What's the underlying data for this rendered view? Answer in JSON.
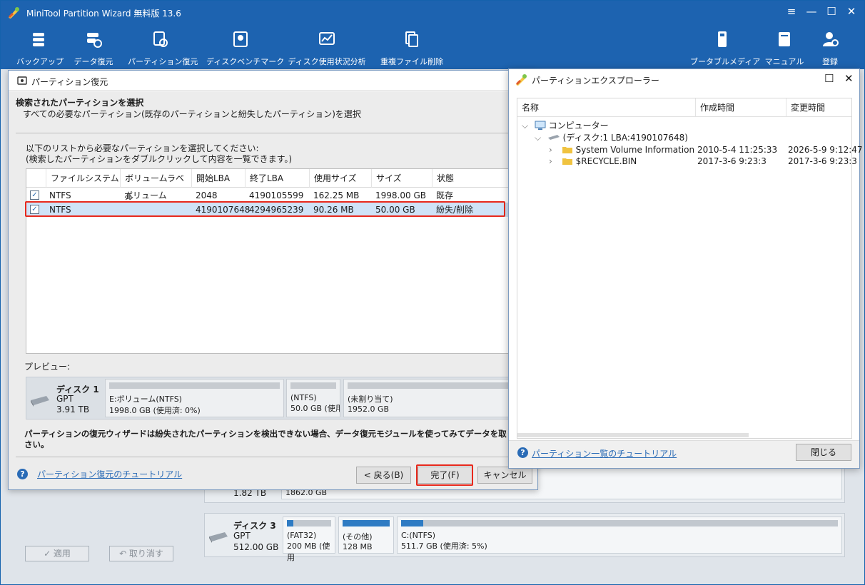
{
  "app": {
    "title": "MiniTool Partition Wizard 無料版 13.6",
    "toolbar": [
      {
        "label": "バックアップ",
        "icon": "backup-icon"
      },
      {
        "label": "データ復元",
        "icon": "data-recovery-icon"
      },
      {
        "label": "パーティション復元",
        "icon": "partition-recovery-icon"
      },
      {
        "label": "ディスクベンチマーク",
        "icon": "disk-benchmark-icon"
      },
      {
        "label": "ディスク使用状況分析",
        "icon": "space-analyzer-icon"
      },
      {
        "label": "重複ファイル削除",
        "icon": "duplicate-file-icon"
      },
      {
        "label": "ブータブルメディア",
        "icon": "bootable-media-icon"
      },
      {
        "label": "マニュアル",
        "icon": "manual-icon"
      },
      {
        "label": "登録",
        "icon": "register-icon"
      }
    ],
    "apply_label": "✓ 適用",
    "undo_label": "↶ 取り消す",
    "bg_disk2": {
      "size": "1.82 TB",
      "seg_size": "1862.0 GB"
    },
    "bg_disk3": {
      "name": "ディスク 3",
      "type": "GPT",
      "size": "512.00 GB",
      "segments": [
        {
          "label": "(FAT32)",
          "detail": "200 MB (使用",
          "used": 0.15
        },
        {
          "label": "(その他)",
          "detail": "128 MB",
          "used": 1.0
        },
        {
          "label": "C:(NTFS)",
          "detail": "511.7 GB (使用済: 5%)",
          "used": 0.05
        }
      ]
    }
  },
  "dialog": {
    "title": "パーティション復元",
    "heading": "検索されたパーティションを選択",
    "subheading": "すべての必要なパーティション(既存のパーティションと紛失したパーティション)を選択",
    "instruction1": "以下のリストから必要なパーティションを選択してください:",
    "instruction2": "(検索したパーティションをダブルクリックして内容を一覧できます。)",
    "columns": [
      "ファイルシステム",
      "ボリュームラベル",
      "開始LBA",
      "終了LBA",
      "使用サイズ",
      "サイズ",
      "状態"
    ],
    "rows": [
      {
        "checked": true,
        "fs": "NTFS",
        "label": "ボリューム",
        "start": "2048",
        "end": "4190105599",
        "used": "162.25 MB",
        "size": "1998.00 GB",
        "state": "既存"
      },
      {
        "checked": true,
        "fs": "NTFS",
        "label": "",
        "start": "4190107648",
        "end": "4294965239",
        "used": "90.26 MB",
        "size": "50.00 GB",
        "state": "紛失/削除"
      }
    ],
    "preview_label": "プレビュー:",
    "preview_disk": {
      "name": "ディスク 1",
      "type": "GPT",
      "size": "3.91 TB"
    },
    "preview_segments": [
      {
        "label": "E:ボリューム(NTFS)",
        "detail": "1998.0 GB (使用済: 0%)"
      },
      {
        "label": "(NTFS)",
        "detail": "50.0 GB (使用"
      },
      {
        "label": "(未割り当て)",
        "detail": "1952.0 GB"
      }
    ],
    "note_line1": "パーティションの復元ウィザードは紛失されたパーティションを検出できない場合、データ復元モジュールを使ってみてデータを取り戻してくだ",
    "note_line2": "さい。",
    "help_link": "パーティション復元のチュートリアル",
    "back_label": "< 戻る(B)",
    "finish_label": "完了(F)",
    "cancel_label": "キャンセル"
  },
  "explorer": {
    "title": "パーティションエクスプローラー",
    "columns": [
      "名称",
      "作成時間",
      "変更時間"
    ],
    "computer": "コンピューター",
    "disk": "(ディスク:1 LBA:4190107648)",
    "items": [
      {
        "name": "System Volume Information",
        "created": "2010-5-4 11:25:33",
        "modified": "2026-5-9 9:12:47"
      },
      {
        "name": "$RECYCLE.BIN",
        "created": "2017-3-6 9:23:3",
        "modified": "2017-3-6 9:23:3"
      }
    ],
    "help_link": "パーティション一覧のチュートリアル",
    "close_label": "閉じる"
  }
}
